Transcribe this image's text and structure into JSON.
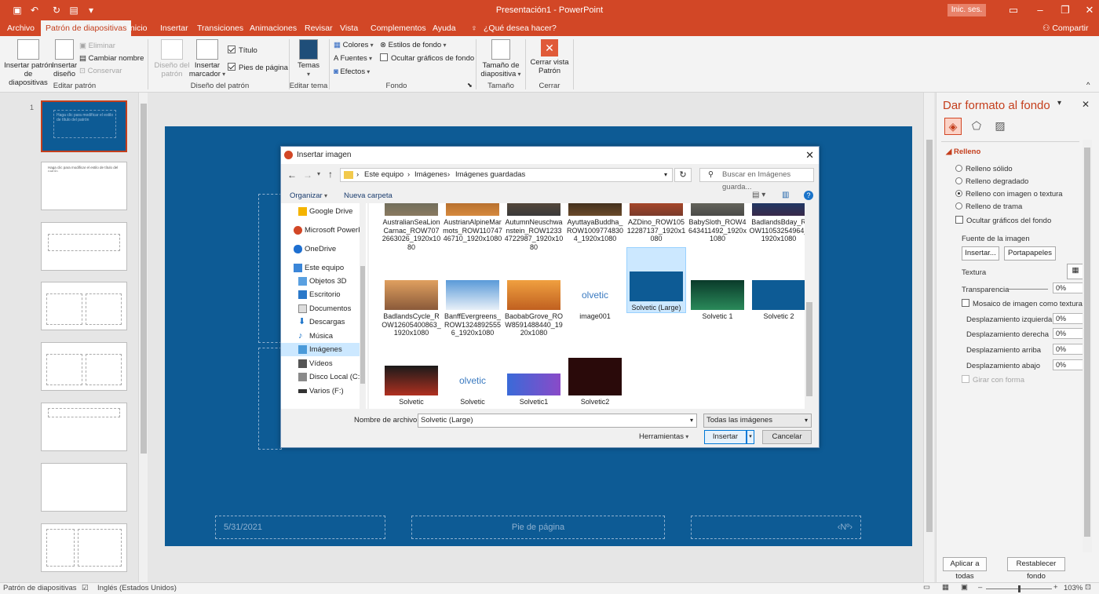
{
  "window": {
    "title": "Presentación1  -  PowerPoint",
    "signin": "Inic. ses."
  },
  "tabs": [
    "Archivo",
    "Patrón de diapositivas",
    "Inicio",
    "Insertar",
    "Transiciones",
    "Animaciones",
    "Revisar",
    "Vista",
    "Complementos",
    "Ayuda"
  ],
  "tell_me": "¿Qué desea hacer?",
  "share": "Compartir",
  "ribbon": {
    "insertar_patron": "Insertar patrón de diapositivas",
    "insertar_diseno": "Insertar diseño",
    "eliminar": "Eliminar",
    "cambiar_nombre": "Cambiar nombre",
    "conservar": "Conservar",
    "group_editar_patron": "Editar patrón",
    "diseno_patron": "Diseño del patrón",
    "insertar_marcador": "Insertar marcador",
    "titulo": "Título",
    "pies_pagina": "Pies de página",
    "group_diseno_patron": "Diseño del patrón",
    "temas": "Temas",
    "group_editar_tema": "Editar tema",
    "colores": "Colores",
    "fuentes": "Fuentes",
    "efectos": "Efectos",
    "estilos_fondo": "Estilos de fondo",
    "ocultar_graficos": "Ocultar gráficos de fondo",
    "group_fondo": "Fondo",
    "tamano_diapositiva": "Tamaño de diapositiva",
    "group_tamano": "Tamaño",
    "cerrar_vista": "Cerrar vista Patrón",
    "group_cerrar": "Cerrar"
  },
  "thumbnails": {
    "numbers": [
      "1"
    ],
    "text": [
      "Haga clic para modificar el estilo de título del patrón",
      "Haga clic para modificar el estilo de título del patrón"
    ]
  },
  "slide": {
    "date": "5/31/2021",
    "footer": "Pie de página",
    "number": "‹Nº›"
  },
  "format_pane": {
    "title": "Dar formato al fondo",
    "section": "Relleno",
    "options": [
      "Relleno sólido",
      "Relleno degradado",
      "Relleno con imagen o textura",
      "Relleno de trama"
    ],
    "hide_graphics": "Ocultar gráficos del fondo",
    "image_source": "Fuente de la imagen",
    "insert_btn": "Insertar...",
    "clipboard_btn": "Portapapeles",
    "texture": "Textura",
    "transparency": "Transparencia",
    "transparency_val": "0%",
    "tile": "Mosaico de imagen como textura",
    "offsets": [
      {
        "label": "Desplazamiento izquierda",
        "value": "0%"
      },
      {
        "label": "Desplazamiento derecha",
        "value": "0%"
      },
      {
        "label": "Desplazamiento arriba",
        "value": "0%"
      },
      {
        "label": "Desplazamiento abajo",
        "value": "0%"
      }
    ],
    "rotate": "Girar con forma",
    "apply_all": "Aplicar a todas",
    "reset": "Restablecer fondo"
  },
  "status": {
    "view": "Patrón de diapositivas",
    "lang": "Inglés (Estados Unidos)",
    "zoom": "103%"
  },
  "dialog": {
    "title": "Insertar imagen",
    "path": [
      "Este equipo",
      "Imágenes",
      "Imágenes guardadas"
    ],
    "search_placeholder": "Buscar en Imágenes guarda...",
    "organize": "Organizar",
    "new_folder": "Nueva carpeta",
    "nav": [
      "Google Drive",
      "Microsoft PowerP",
      "OneDrive",
      "Este equipo",
      "Objetos 3D",
      "Escritorio",
      "Documentos",
      "Descargas",
      "Música",
      "Imágenes",
      "Vídeos",
      "Disco Local (C:)",
      "Varios (F:)"
    ],
    "selected_nav": "Imágenes",
    "files_row1": [
      "AustralianSeaLionCarnac_ROW7072663026_1920x1080",
      "AustrianAlpineMarmots_ROW11074746710_1920x1080",
      "AutumnNeuschwanstein_ROW12334722987_1920x1080",
      "AyuttayaBuddha_ROW10097748304_1920x1080",
      "AZDino_ROW10512287137_1920x1080",
      "BabySloth_ROW4643411492_1920x1080",
      "BadlandsBday_ROW11053254964_1920x1080"
    ],
    "files_row2": [
      "BadlandsCycle_ROW12605400863_1920x1080",
      "BanffEvergreens_ROW13248925556_1920x1080",
      "BaobabGrove_ROW8591488440_1920x1080",
      "image001",
      "Solvetic (Large)",
      "Solvetic 1",
      "Solvetic 2"
    ],
    "files_row3": [
      "Solvetic",
      "Solvetic",
      "Solvetic1",
      "Solvetic2"
    ],
    "filename_label": "Nombre de archivo:",
    "filename": "Solvetic (Large)",
    "filter": "Todas las imágenes",
    "tools": "Herramientas",
    "insert": "Insertar",
    "cancel": "Cancelar",
    "logo_text": "olvetic"
  }
}
